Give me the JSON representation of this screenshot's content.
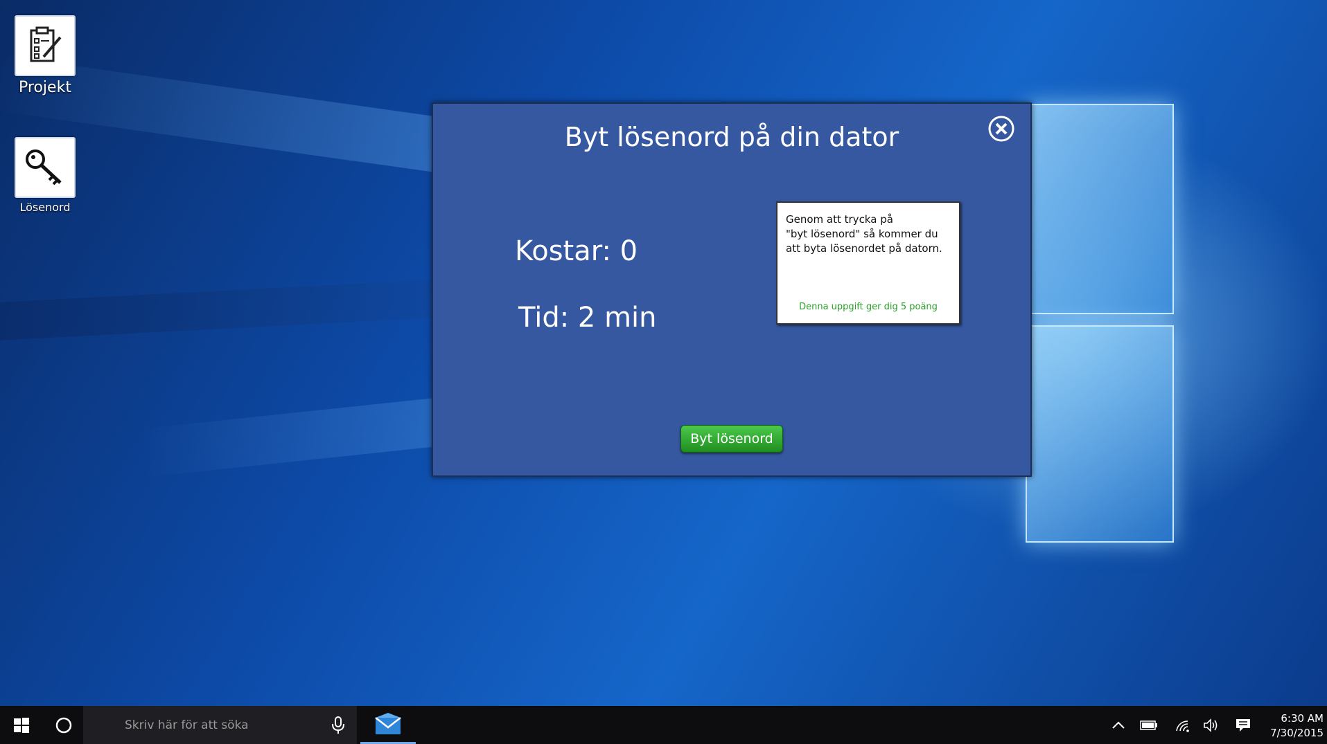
{
  "desktop": {
    "icons": [
      {
        "label": "Projekt",
        "icon": "clipboard-edit-icon"
      },
      {
        "label": "Lösenord",
        "icon": "key-icon"
      }
    ]
  },
  "dialog": {
    "title": "Byt lösenord på din dator",
    "close_icon": "close-circle-icon",
    "cost": "Kostar: 0",
    "time": "Tid: 2 min",
    "info_text": "Genom att trycka på\n\"byt lösenord\" så kommer du\natt byta lösenordet på datorn.",
    "info_points": "Denna uppgift ger dig 5 poäng",
    "action_button": "Byt lösenord",
    "colors": {
      "background": "#3558a0",
      "button": "#2ca62c",
      "points_text": "#2aa02a"
    }
  },
  "taskbar": {
    "search_placeholder": "Skriv här för att söka",
    "pinned": [
      {
        "icon": "mail-icon"
      }
    ],
    "tray": [
      "chevron-up-icon",
      "battery-icon",
      "wifi-icon",
      "volume-icon",
      "notifications-icon"
    ],
    "time": "6:30 AM",
    "date": "7/30/2015"
  }
}
